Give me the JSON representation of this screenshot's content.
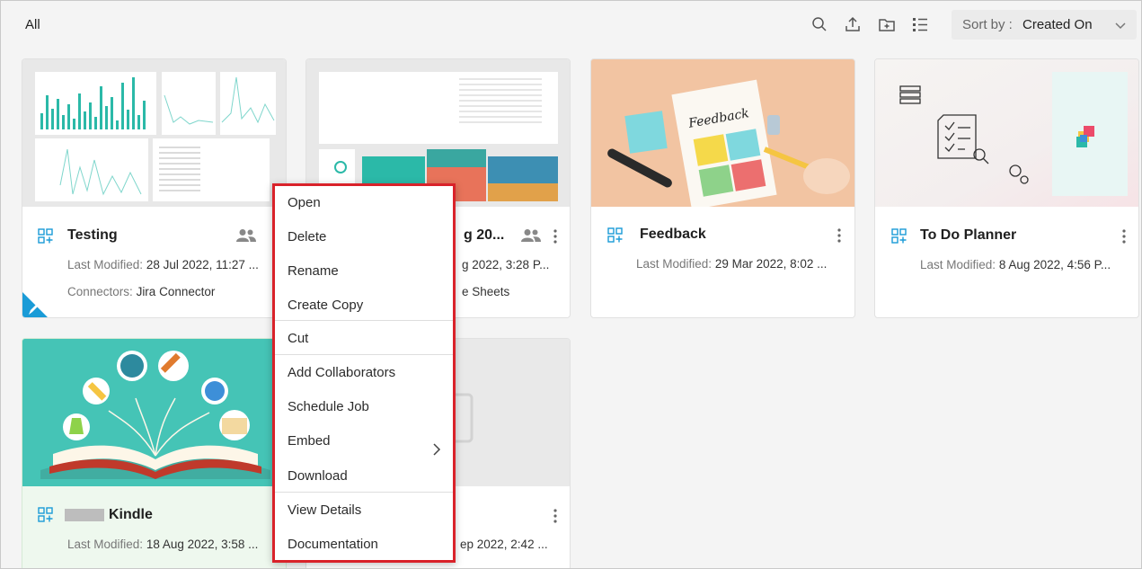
{
  "toolbar": {
    "breadcrumb": "All",
    "sort_label": "Sort by :",
    "sort_value": "Created On",
    "icons": [
      "search-icon",
      "upload-icon",
      "new-folder-icon",
      "list-view-icon",
      "chevron-down-icon"
    ]
  },
  "cards": [
    {
      "title": "Testing",
      "modified_label": "Last Modified:",
      "modified_value": "28 Jul 2022, 11:27 ...",
      "connectors_label": "Connectors:",
      "connectors_value": "Jira Connector",
      "shared": true,
      "editable_corner": true
    },
    {
      "title": "g 20...",
      "modified_value": "g 2022, 3:28 P...",
      "connectors_value": "e Sheets",
      "shared": true
    },
    {
      "title": "Feedback",
      "modified_label": "Last Modified:",
      "modified_value": "29 Mar 2022, 8:02 ...",
      "thumb_text": "Feedback"
    },
    {
      "title": "To Do Planner",
      "modified_label": "Last Modified:",
      "modified_value": "8 Aug 2022, 4:56 P..."
    },
    {
      "title": "Kindle",
      "modified_label": "Last Modified:",
      "modified_value": "18 Aug 2022, 3:58 ..."
    },
    {
      "modified_value": "ep 2022, 2:42 ..."
    }
  ],
  "context_menu": {
    "items": [
      "Open",
      "Delete",
      "Rename",
      "Create Copy",
      "Cut",
      "Add Collaborators",
      "Schedule Job",
      "Embed",
      "Download",
      "View Details",
      "Documentation"
    ]
  },
  "colors": {
    "accent": "#1a9bd7",
    "menu_highlight": "#d9222a",
    "teal": "#2bb9a8",
    "background": "#f4f4f4"
  }
}
